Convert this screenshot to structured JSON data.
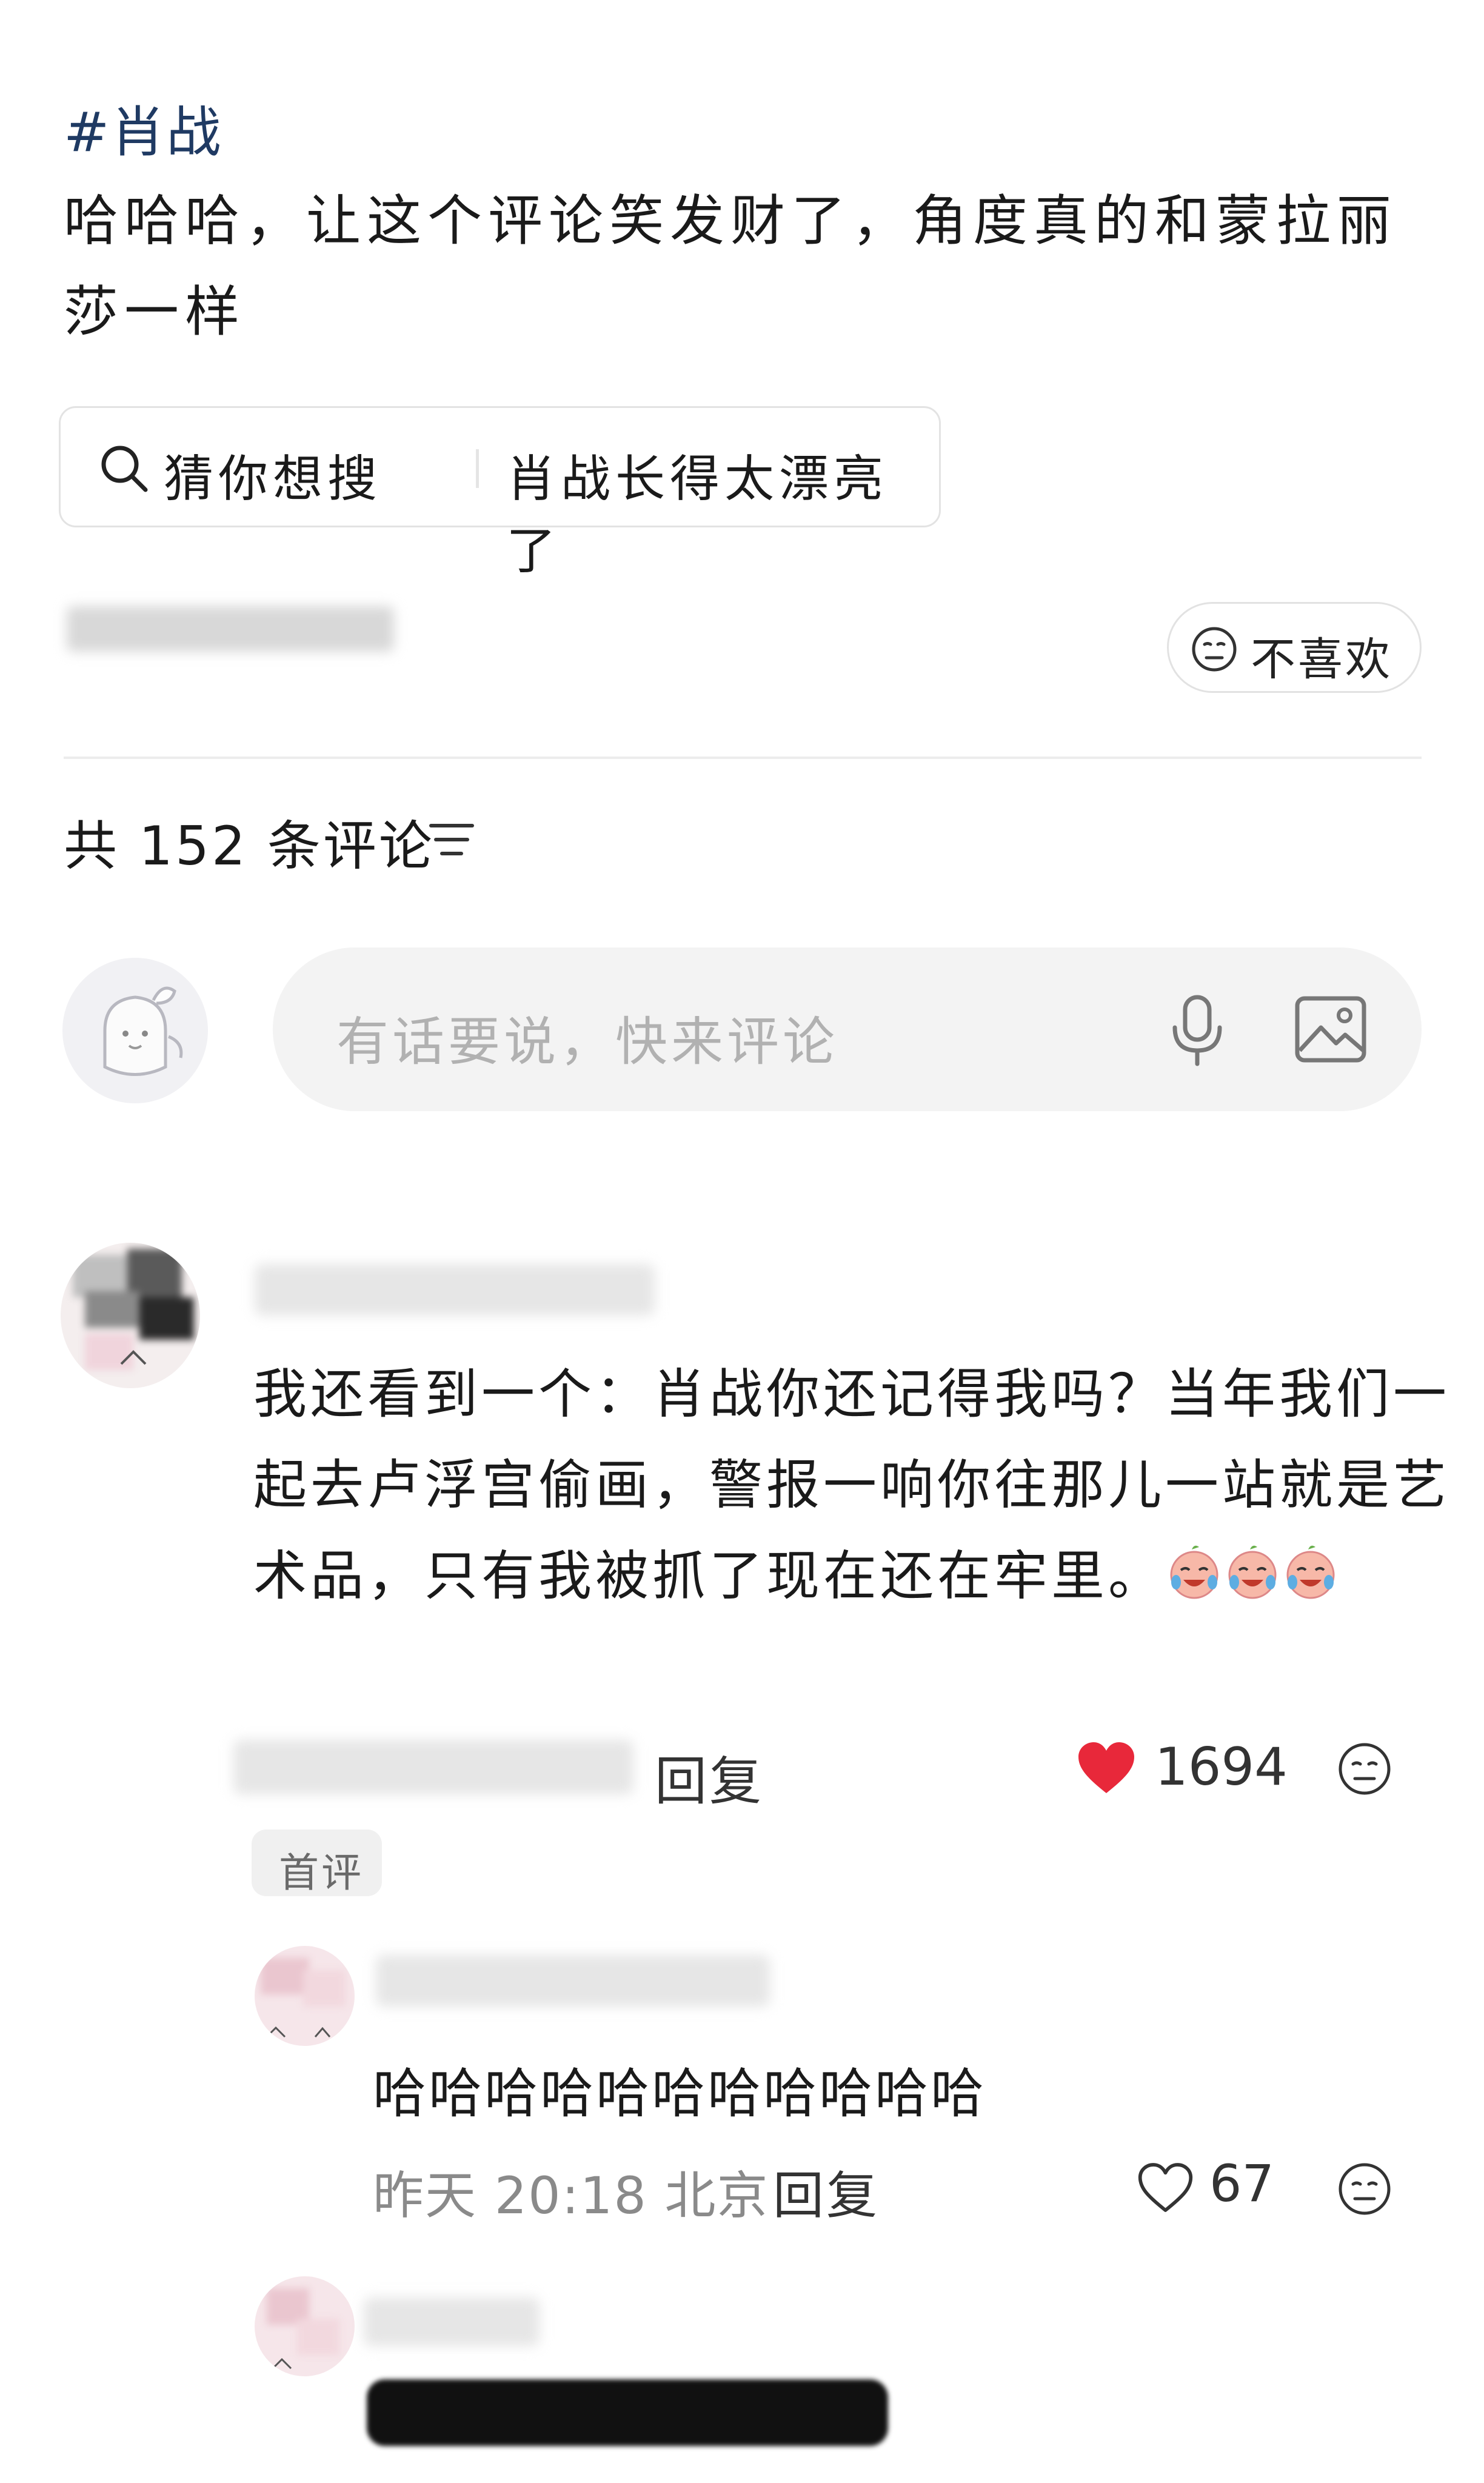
{
  "post": {
    "hashtag": "#肖战",
    "text": "哈哈哈，让这个评论笑发财了，角度真的和蒙拉丽莎一样"
  },
  "guess_search": {
    "label": "猜你想搜",
    "query": "肖战长得太漂亮了"
  },
  "post_meta": {
    "dislike_label": "不喜欢"
  },
  "comments_header": {
    "count_text": "共 152 条评论"
  },
  "comment_input": {
    "placeholder": "有话要说，快来评论"
  },
  "comments": [
    {
      "text": "我还看到一个：肖战你还记得我吗？当年我们一起去卢浮宫偷画，警报一响你往那儿一站就是艺术品，只有我被抓了现在还在牢里。",
      "reply_label": "回复",
      "likes": "1694",
      "badge": "首评",
      "replies": [
        {
          "text": "哈哈哈哈哈哈哈哈哈哈哈",
          "meta": "昨天 20:18 北京",
          "reply_label": "回复",
          "likes": "67"
        }
      ]
    }
  ],
  "colors": {
    "hashtag": "#1f3a63",
    "like_red": "#e8283a",
    "placeholder": "#b1b1b1"
  },
  "icons": [
    "search-icon",
    "dislike-face-icon",
    "sort-icon",
    "microphone-icon",
    "image-icon",
    "heart-filled-icon",
    "heart-outline-icon",
    "meh-face-icon",
    "laugh-cry-emoji"
  ]
}
